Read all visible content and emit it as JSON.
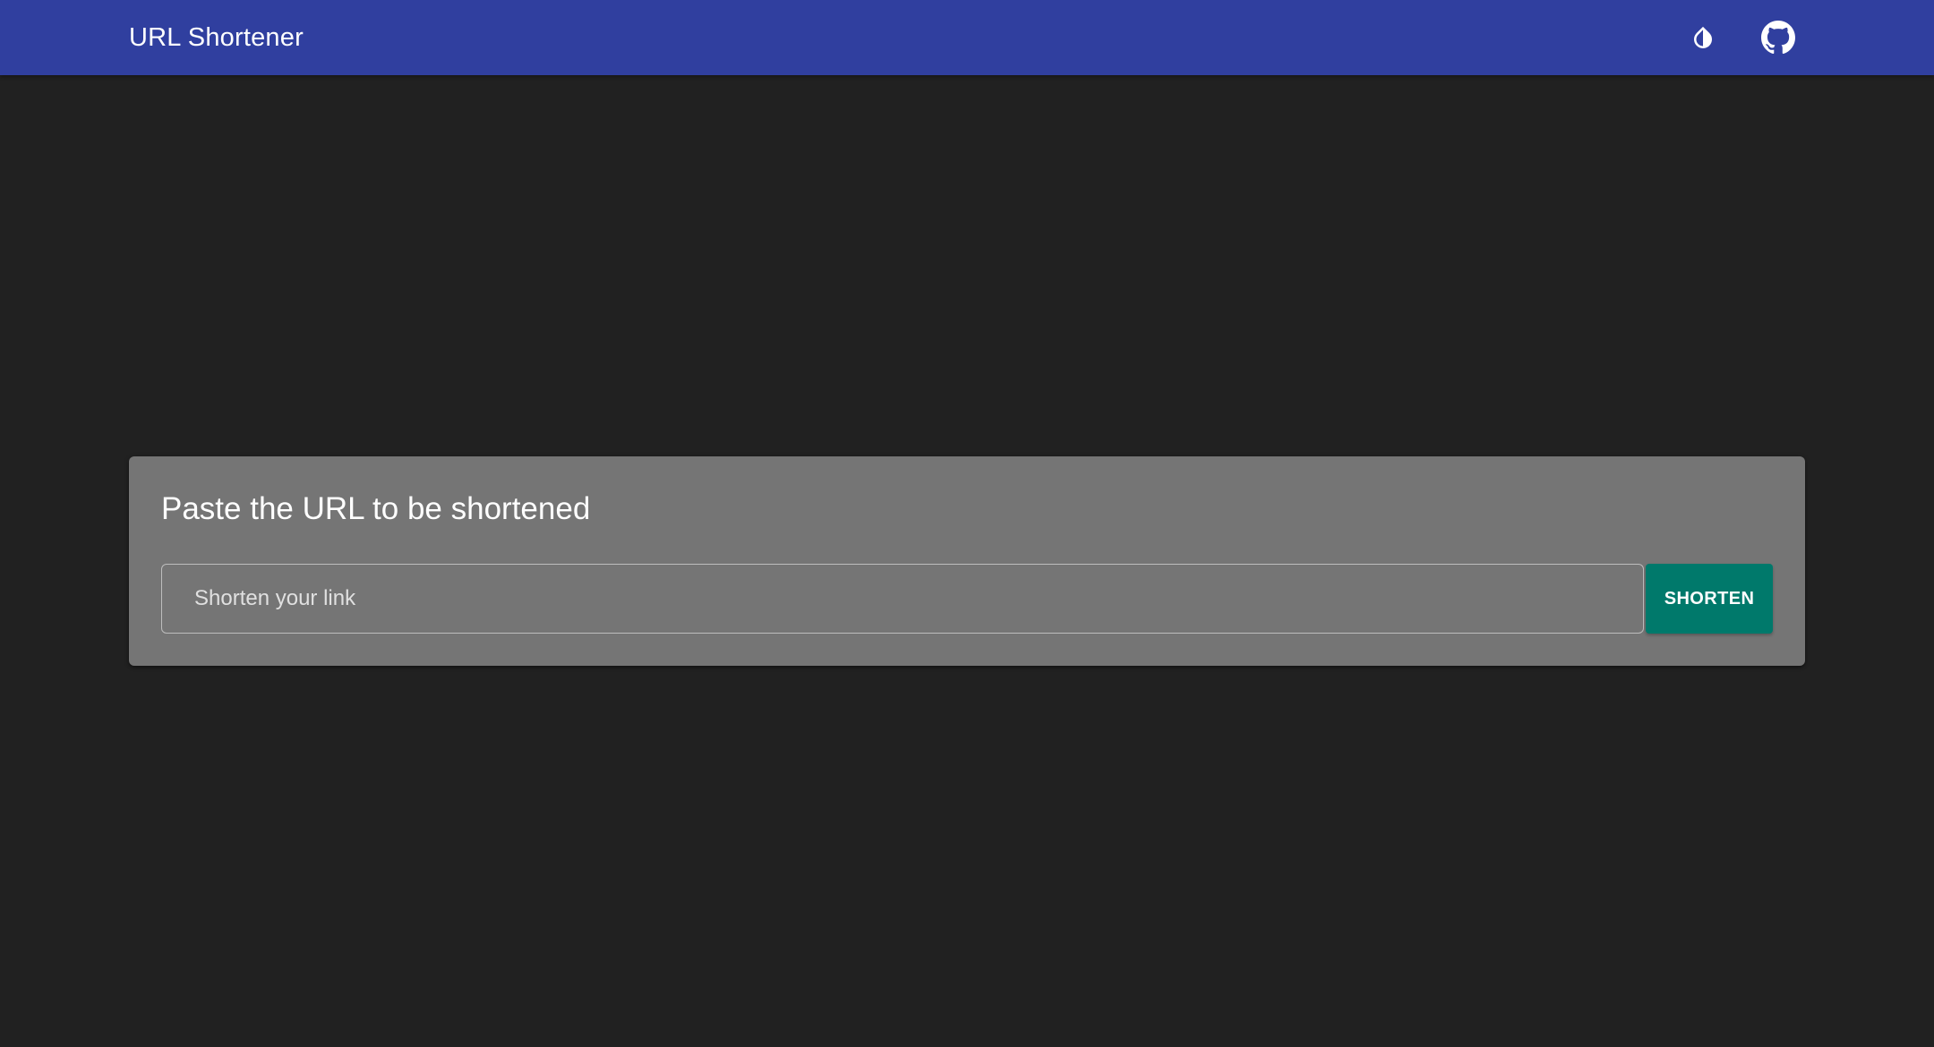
{
  "app_bar": {
    "title": "URL Shortener",
    "icons": {
      "theme_toggle": "invert-colors-icon",
      "github": "github-icon"
    },
    "background_color": "#303f9f"
  },
  "card": {
    "title": "Paste the URL to be shortened",
    "input": {
      "placeholder": "Shorten your link",
      "value": ""
    },
    "button_label": "SHORTEN",
    "button_color": "#00796b",
    "background_color": "#757575"
  },
  "page": {
    "background_color": "#212121"
  }
}
